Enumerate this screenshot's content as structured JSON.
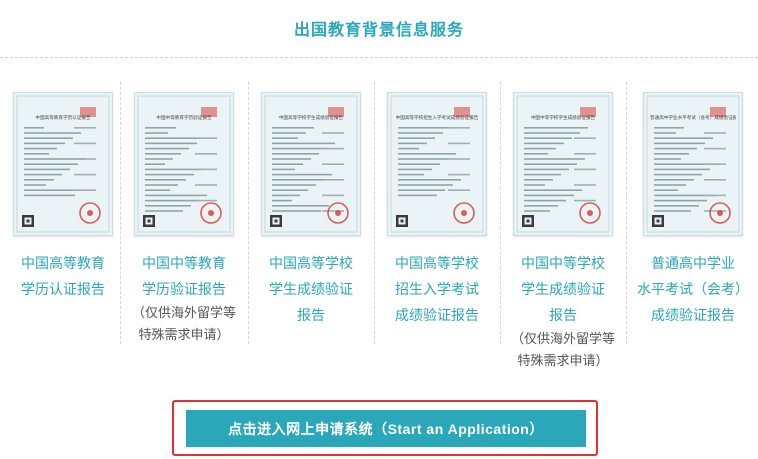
{
  "header": {
    "title": "出国教育背景信息服务"
  },
  "colors": {
    "accent": "#2aa7b8",
    "highlight_border": "#e5312e",
    "seal": "#d9423a"
  },
  "cards": [
    {
      "thumb_heading": "中国高等教育学历认证报告",
      "label_lines": [
        "中国高等教育",
        "学历认证报告"
      ],
      "note_lines": []
    },
    {
      "thumb_heading": "中国中等教育学历验证报告",
      "label_lines": [
        "中国中等教育",
        "学历验证报告"
      ],
      "note_lines": [
        "（仅供海外留学等",
        "特殊需求申请）"
      ]
    },
    {
      "thumb_heading": "中国高等学校学生成绩验证报告",
      "label_lines": [
        "中国高等学校",
        "学生成绩验证",
        "报告"
      ],
      "note_lines": []
    },
    {
      "thumb_heading": "中国高等学校招生入学考试成绩验证报告",
      "label_lines": [
        "中国高等学校",
        "招生入学考试",
        "成绩验证报告"
      ],
      "note_lines": []
    },
    {
      "thumb_heading": "中国中等学校学生成绩验证报告",
      "label_lines": [
        "中国中等学校",
        "学生成绩验证",
        "报告"
      ],
      "note_lines": [
        "（仅供海外留学等",
        "特殊需求申请）"
      ]
    },
    {
      "thumb_heading": "普通高中学业水平考试（会考）成绩验证报告",
      "label_lines": [
        "普通高中学业",
        "水平考试（会考）",
        "成绩验证报告"
      ],
      "note_lines": []
    }
  ],
  "cta": {
    "label": "点击进入网上申请系统（Start an Application）"
  }
}
